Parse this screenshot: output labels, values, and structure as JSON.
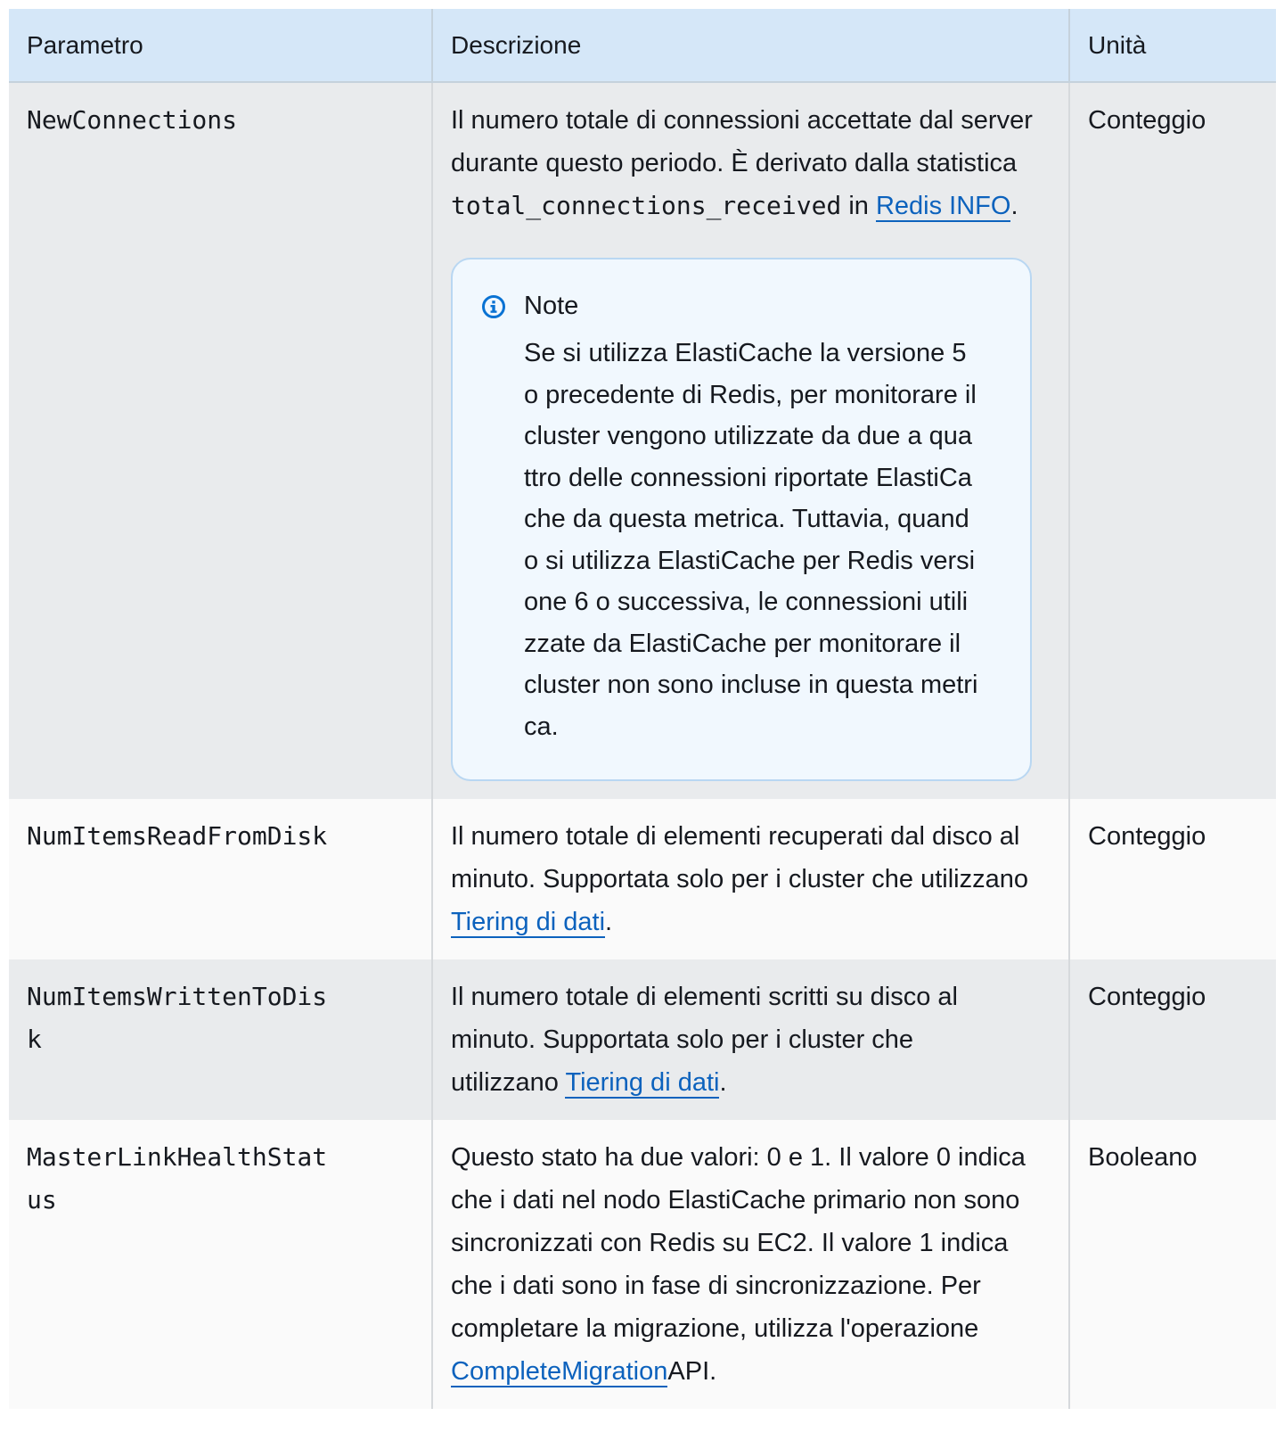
{
  "header": {
    "col_parameter": "Parametro",
    "col_description": "Descrizione",
    "col_unit": "Unità"
  },
  "rows": [
    {
      "parameter": "NewConnections",
      "desc_part1": "Il numero totale di connessioni accettate dal server durante questo periodo. È derivato dalla statistica ",
      "desc_code": "total_connections_received",
      "desc_part2": " in ",
      "desc_link": "Redis INFO",
      "desc_part3": ".",
      "note_title": "Note",
      "note_text": "Se si utilizza ElastiCache la versione 5 o precedente di Redis, per monitorare il cluster vengono utilizzate da due a quattro delle connessioni riportate ElastiCache da questa metrica. Tuttavia, quando si utilizza ElastiCache per Redis versione 6 o successiva, le connessioni utilizzate da ElastiCache per monitorare il cluster non sono incluse in questa metrica.",
      "unit": "Conteggio"
    },
    {
      "parameter": "NumItemsReadFromDisk",
      "desc_part1": "Il numero totale di elementi recuperati dal disco al minuto. Supportata solo per i cluster che utilizzano ",
      "desc_link": "Tiering di dati",
      "desc_part2": ".",
      "unit": "Conteggio"
    },
    {
      "parameter": "NumItemsWrittenToDisk",
      "desc_part1": "Il numero totale di elementi scritti su disco al minuto. Supportata solo per i cluster che utilizzano ",
      "desc_link": "Tiering di dati",
      "desc_part2": ".",
      "unit": "Conteggio"
    },
    {
      "parameter": "MasterLinkHealthStatus",
      "desc_part1": "Questo stato ha due valori: 0 e 1. Il valore 0 indica che i dati nel nodo ElastiCache primario non sono sincronizzati con Redis su EC2. Il valore 1 indica che i dati sono in fase di sincronizzazione. Per completare la migrazione, utilizza l'operazione ",
      "desc_link": "CompleteMigration",
      "desc_part2": "API.",
      "unit": "Booleano"
    }
  ],
  "colors": {
    "header_bg": "#d5e7f8",
    "row_odd_bg": "#e9ebed",
    "row_even_bg": "#fafafa",
    "link": "#0c62bd",
    "note_bg": "#f1f8fe",
    "note_border": "#b9d7f2",
    "info_icon": "#0972d3"
  },
  "icons": {
    "note_icon": "info-icon"
  }
}
